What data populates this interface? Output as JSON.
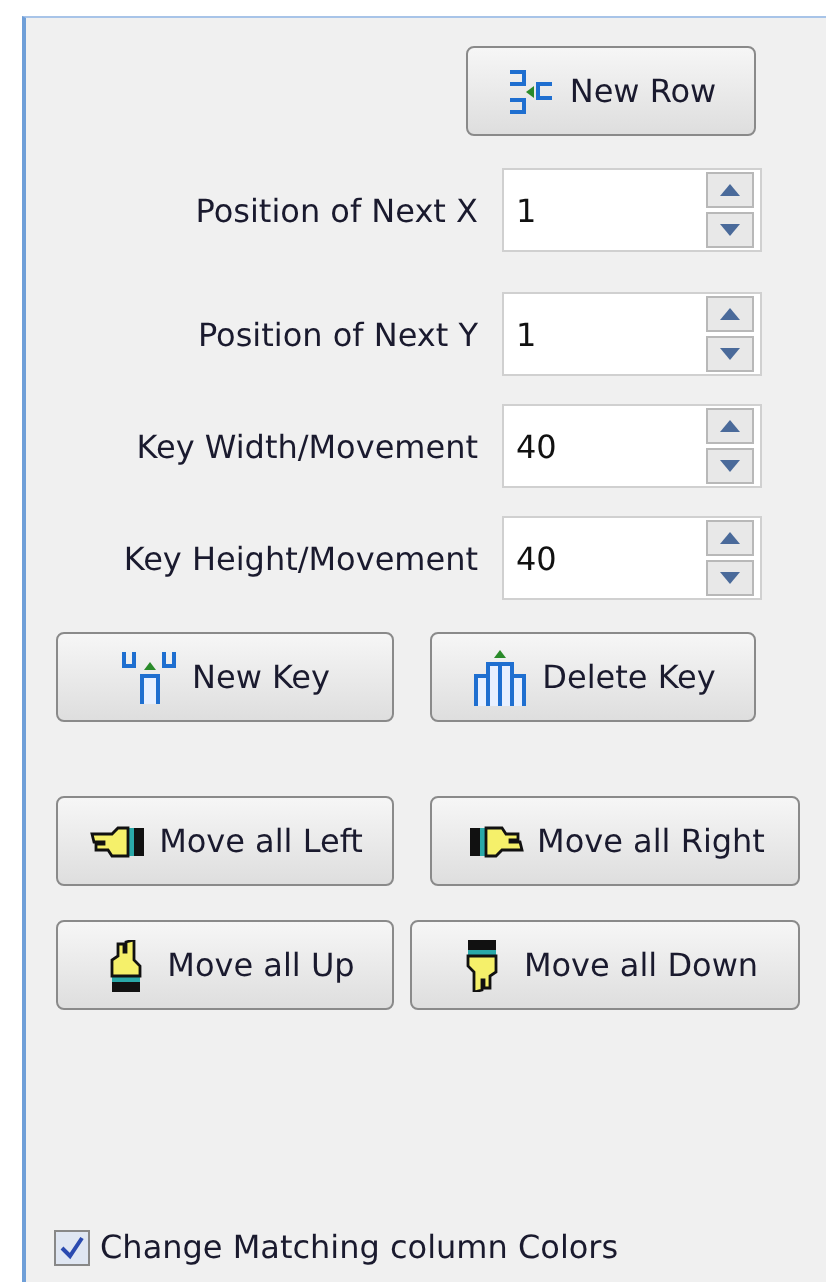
{
  "new_row_button": {
    "label": "New Row"
  },
  "fields": [
    {
      "label": "Position of Next X",
      "value": "1"
    },
    {
      "label": "Position of Next Y",
      "value": "1"
    },
    {
      "label": "Key Width/Movement",
      "value": "40"
    },
    {
      "label": "Key Height/Movement",
      "value": "40"
    }
  ],
  "key_buttons": [
    {
      "label": "New Key"
    },
    {
      "label": "Delete Key"
    }
  ],
  "move_buttons": [
    {
      "label": "Move all Left"
    },
    {
      "label": "Move all Right"
    },
    {
      "label": "Move all Up"
    },
    {
      "label": "Move all Down"
    }
  ],
  "checkbox": {
    "label": "Change Matching column Colors",
    "checked": true
  }
}
